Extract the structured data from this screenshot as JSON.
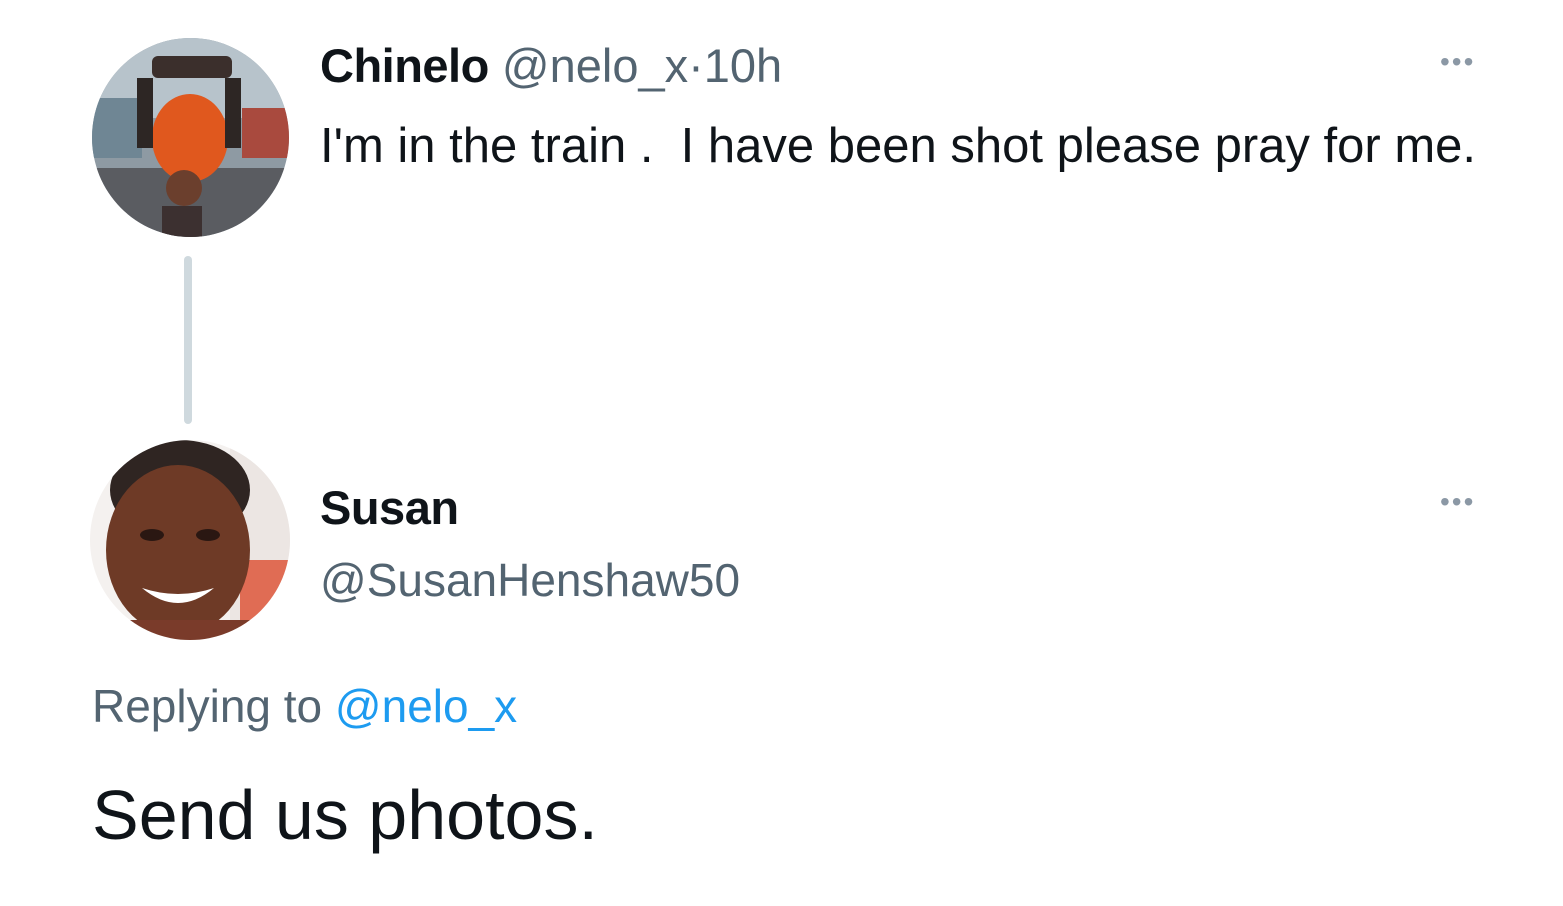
{
  "tweet": {
    "author_name": "Chinelo",
    "author_handle": "@nelo_x",
    "separator": "·",
    "time": "10h",
    "text": "I'm in the train .  I have been shot please pray for me.",
    "more_icon": "more-horizontal-icon"
  },
  "reply": {
    "author_name": "Susan",
    "author_handle": "@SusanHenshaw50",
    "replying_prefix": "Replying to",
    "replying_to": "@nelo_x",
    "text": "Send us photos.",
    "more_icon": "more-horizontal-icon"
  },
  "colors": {
    "text": "#0f1419",
    "secondary": "#536471",
    "link": "#1d9bf0",
    "thread_line": "#cfd9de"
  }
}
